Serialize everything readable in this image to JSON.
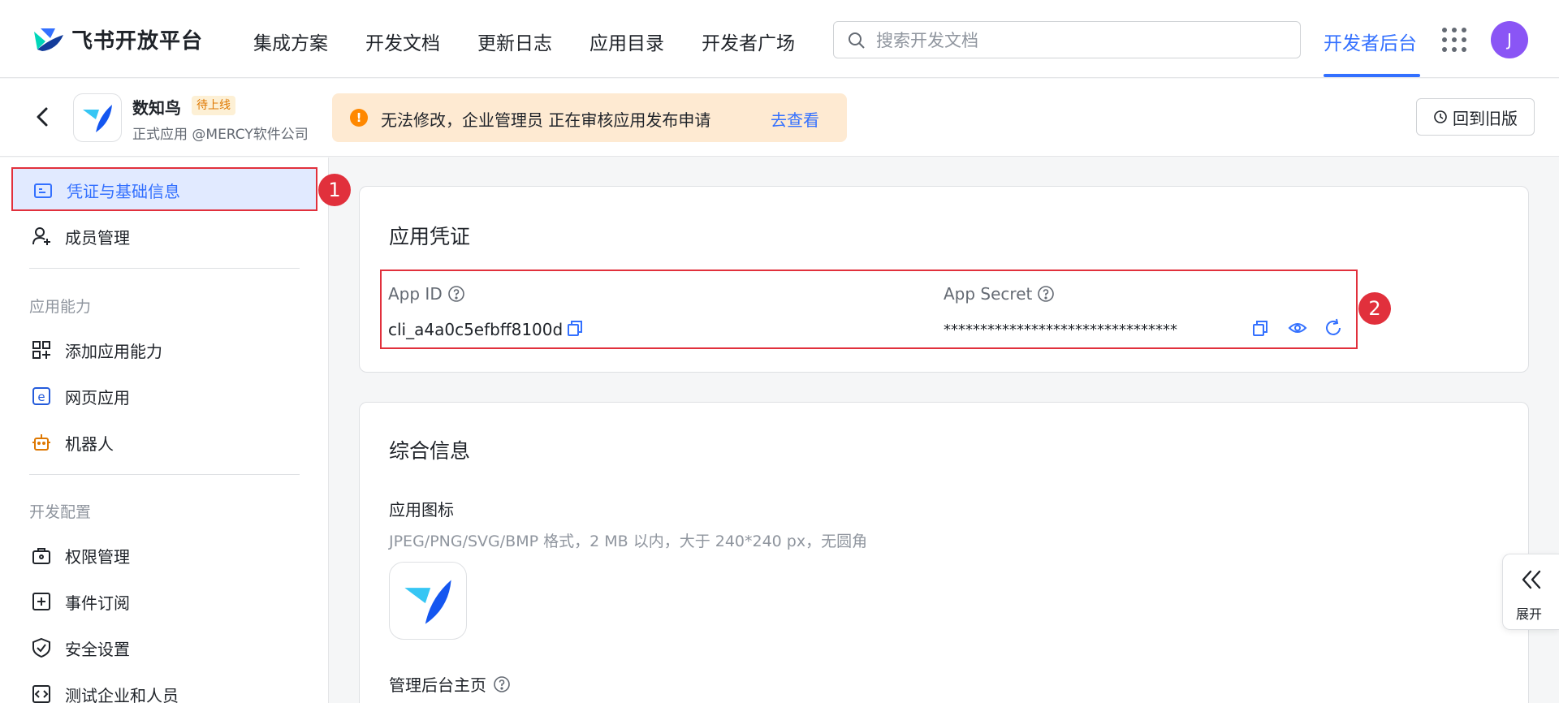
{
  "brand": {
    "name": "飞书开放平台"
  },
  "nav": {
    "items": [
      "集成方案",
      "开发文档",
      "更新日志",
      "应用目录",
      "开发者广场"
    ],
    "dev_console": "开发者后台",
    "avatar_letter": "J"
  },
  "search": {
    "placeholder": "搜索开发文档",
    "value": ""
  },
  "app": {
    "name": "数知鸟",
    "status": "待上线",
    "subtitle": "正式应用 @MERCY软件公司"
  },
  "alert": {
    "icon": "!",
    "text": "无法修改，企业管理员 正在审核应用发布申请",
    "link": "去查看"
  },
  "old_version_button": "回到旧版",
  "sidebar": {
    "active": "凭证与基础信息",
    "member": "成员管理",
    "groups": [
      {
        "title": "应用能力",
        "items": [
          "添加应用能力",
          "网页应用",
          "机器人"
        ]
      },
      {
        "title": "开发配置",
        "items": [
          "权限管理",
          "事件订阅",
          "安全设置",
          "测试企业和人员"
        ]
      }
    ]
  },
  "markers": [
    "1",
    "2"
  ],
  "credentials": {
    "title": "应用凭证",
    "app_id_label": "App ID",
    "app_id_value": "cli_a4a0c5efbff8100d",
    "app_secret_label": "App Secret",
    "app_secret_value": "********************************"
  },
  "info": {
    "title": "综合信息",
    "icon_label": "应用图标",
    "icon_hint": "JPEG/PNG/SVG/BMP 格式，2 MB 以内，大于 240*240 px，无圆角",
    "admin_home_label": "管理后台主页"
  },
  "expand": {
    "label": "展开"
  },
  "colors": {
    "accent": "#3370ff",
    "highlight": "#e1303c",
    "warning": "#ff8800"
  }
}
